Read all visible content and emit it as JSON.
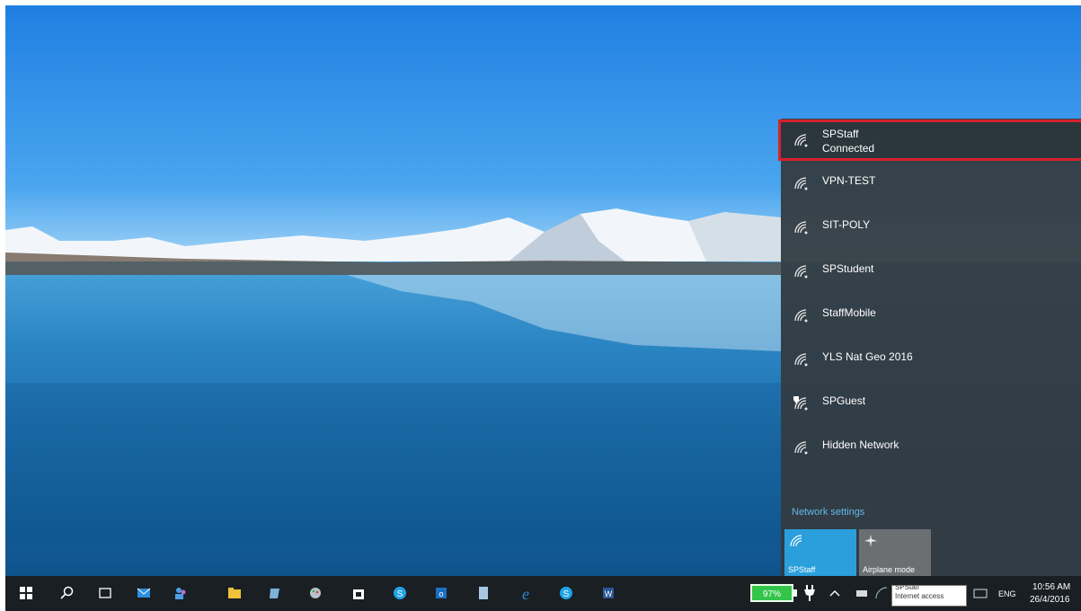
{
  "networks": [
    {
      "ssid": "SPStaff",
      "status": "Connected",
      "icon": "wifi-icon"
    },
    {
      "ssid": "VPN-TEST",
      "icon": "wifi-icon"
    },
    {
      "ssid": "SIT-POLY",
      "icon": "wifi-icon"
    },
    {
      "ssid": "SPStudent",
      "icon": "wifi-icon"
    },
    {
      "ssid": "StaffMobile",
      "icon": "wifi-icon"
    },
    {
      "ssid": "YLS Nat Geo 2016",
      "icon": "wifi-icon"
    },
    {
      "ssid": "SPGuest",
      "icon": "wifi-shield-icon"
    },
    {
      "ssid": "Hidden Network",
      "icon": "wifi-icon"
    }
  ],
  "flyout": {
    "settings_link": "Network settings",
    "quick_actions": [
      {
        "label": "SPStaff",
        "icon": "wifi-icon",
        "active": true
      },
      {
        "label": "Airplane mode",
        "icon": "airplane-icon",
        "active": false
      }
    ]
  },
  "taskbar": {
    "apps": [
      "start-icon",
      "search-icon",
      "task-view-icon",
      "mail-icon",
      "people-icon",
      "file-explorer-icon",
      "calculator-icon",
      "paint-icon",
      "store-icon",
      "skype-icon",
      "outlook-icon",
      "notepad-icon",
      "edge-icon",
      "skype-business-icon",
      "word-icon"
    ],
    "battery_percent": "97%",
    "tooltip": "Internet access",
    "tooltip_partial": "SPStaff",
    "language": "ENG",
    "time": "10:56 AM",
    "date": "26/4/2016"
  },
  "colors": {
    "accent": "#2a9fdb",
    "highlight_border": "#d6232d",
    "link": "#63b7ea",
    "battery": "#33c54a"
  }
}
